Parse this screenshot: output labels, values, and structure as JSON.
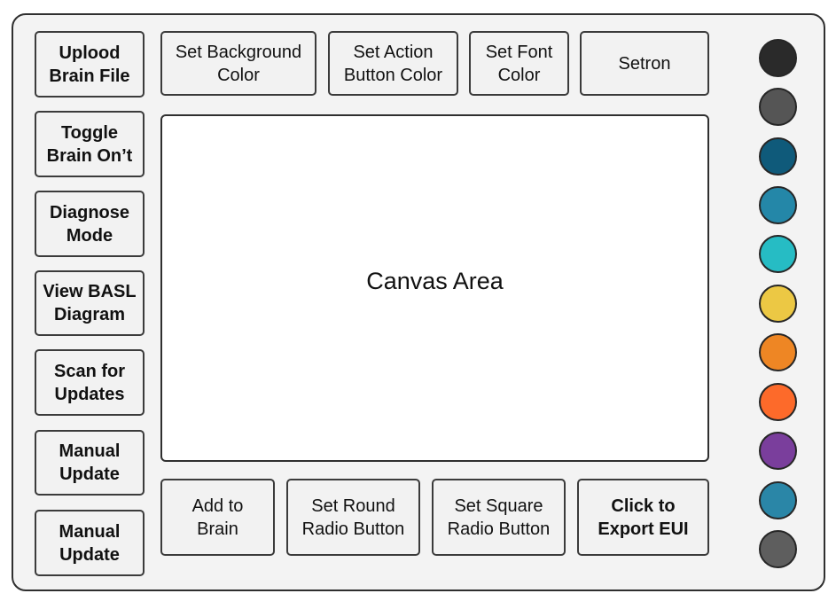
{
  "sidebar": {
    "buttons": [
      {
        "label": "Uplood\nBrain File"
      },
      {
        "label": "Toggle\nBrain On’t"
      },
      {
        "label": "Diagnose\nMode"
      },
      {
        "label": "View BASL\nDiagram"
      },
      {
        "label": "Scan for\nUpdates"
      },
      {
        "label": "Manual\nUpdate"
      },
      {
        "label": "Manual\nUpdate"
      }
    ]
  },
  "toolbar": {
    "buttons": [
      {
        "label": "Set Background\nColor"
      },
      {
        "label": "Set Action\nButton Color"
      },
      {
        "label": "Set Font\nColor"
      },
      {
        "label": "Setron"
      }
    ]
  },
  "canvas": {
    "label": "Canvas Area"
  },
  "bottom_bar": {
    "buttons": [
      {
        "label": "Add to\nBrain"
      },
      {
        "label": "Set Round\nRadio Button"
      },
      {
        "label": "Set Square\nRadio Button"
      },
      {
        "label": "Click to\nExport EUI"
      }
    ]
  },
  "palette": {
    "colors": [
      "#2a2a2a",
      "#555555",
      "#0f5a7a",
      "#2487a8",
      "#26bcc4",
      "#ecc844",
      "#ee8624",
      "#fd6a2a",
      "#7a3e9c",
      "#2a86a7",
      "#5e5e5e"
    ]
  }
}
